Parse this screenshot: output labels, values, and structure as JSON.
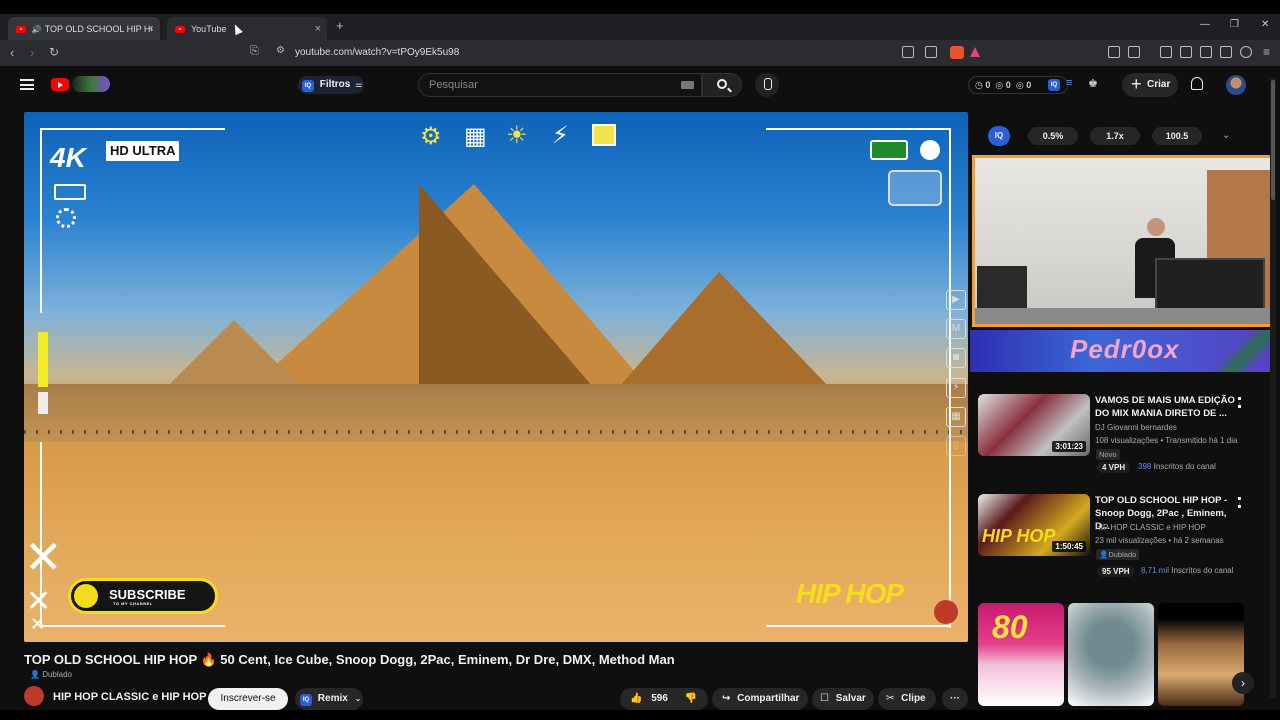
{
  "browser": {
    "tabs": [
      {
        "label": "TOP OLD SCHOOL HIP HOP 🔥",
        "audio": "🔊",
        "active": false
      },
      {
        "label": "YouTube",
        "active": true
      }
    ],
    "new_tab": "+",
    "url": "youtube.com/watch?v=tPOy9Ek5u98",
    "window_controls": [
      "—",
      "❐",
      "✕"
    ]
  },
  "header": {
    "filters_label": "Filtros",
    "search_placeholder": "Pesquisar",
    "counters": [
      "0",
      "0",
      "0"
    ],
    "create_label": "Criar"
  },
  "player": {
    "overlay_4k": "4K",
    "overlay_hd": "HD ULTRA",
    "subscribe_main": "SUBSCRIBE",
    "subscribe_sub": "TO MY CHANNEL",
    "hiphop_logo": "HIP HOP",
    "side_icons": [
      "▶",
      "M",
      "◙",
      "⚡",
      "▦",
      "▯"
    ]
  },
  "video": {
    "title": "TOP OLD SCHOOL HIP HOP 🔥 50 Cent, Ice Cube, Snoop Dogg, 2Pac, Eminem, Dr Dre, DMX, Method Man",
    "dubbed": "Dublado",
    "channel": "HIP HOP CLASSIC e HIP HOP",
    "subscribe": "Inscrever-se",
    "remix": "Remix",
    "likes": "596",
    "share": "Compartilhar",
    "save": "Salvar",
    "clip": "Clipe"
  },
  "extension": {
    "chips": [
      "0.5%",
      "1.7x",
      "100.5"
    ]
  },
  "banner": {
    "text": "Pedr0ox"
  },
  "recommendations": [
    {
      "title": "VAMOS  DE MAIS UMA EDIÇÃO DO MIX MANIA DIRETO DE ...",
      "channel": "DJ Giovanni bernardes",
      "meta": "108 visualizações • Transmitido há 1 dia",
      "tag": "Novo",
      "duration": "3:01:23",
      "vph": "4 VPH",
      "subs_count": "398",
      "subs_label": "Inscritos do canal"
    },
    {
      "title": "TOP OLD SCHOOL HIP HOP - Snoop Dogg, 2Pac , Eminem, D...",
      "channel": "HIP HOP CLASSIC e HIP HOP",
      "meta": "23 mil visualizações • há 2 semanas",
      "tag": "Dublado",
      "duration": "1:50:45",
      "vph": "95 VPH",
      "subs_count": "8,71 mil",
      "subs_label": "Inscritos do canal"
    }
  ],
  "colors": {
    "accent": "#ff0000",
    "subscribe_yellow": "#f6dc1c",
    "webcam_border": "#f3a032",
    "link_blue": "#5d8fe6"
  }
}
